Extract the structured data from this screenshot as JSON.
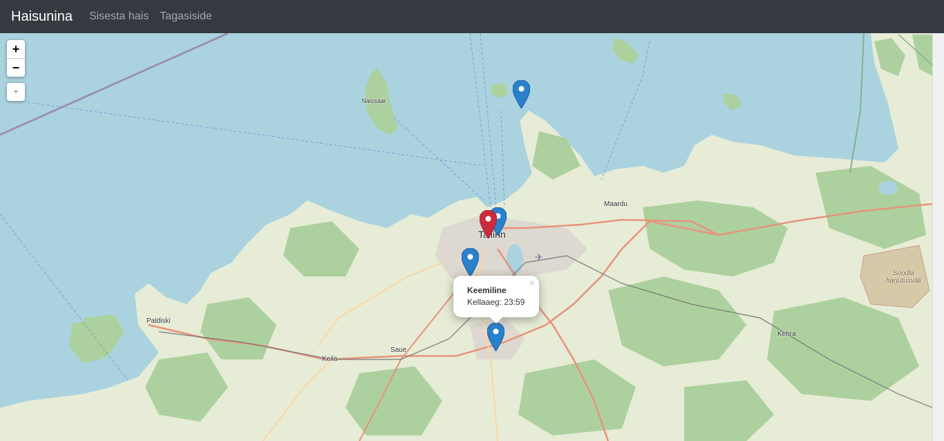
{
  "navbar": {
    "brand": "Haisunina",
    "links": [
      "Sisesta hais",
      "Tagasiside"
    ]
  },
  "map": {
    "zoom_in": "+",
    "zoom_out": "−",
    "locate": "÷",
    "places": {
      "tallinn": "Tallinn",
      "maardu": "Maardu",
      "paldiski": "Paldiski",
      "keila": "Keila",
      "saue": "Saue",
      "kehra": "Kehra",
      "naissaar": "Naissaar",
      "soodla": "Soodla\nharjutusväli"
    },
    "popup": {
      "title": "Keemiline",
      "text": "Kellaaeg: 23:59",
      "close": "×"
    },
    "colors": {
      "water": "#aad3df",
      "land": "#f2efe9",
      "forest": "#add19e",
      "marker_blue": "#2a81cb",
      "marker_red": "#cb2b3e",
      "road_major": "#e8927c"
    }
  }
}
